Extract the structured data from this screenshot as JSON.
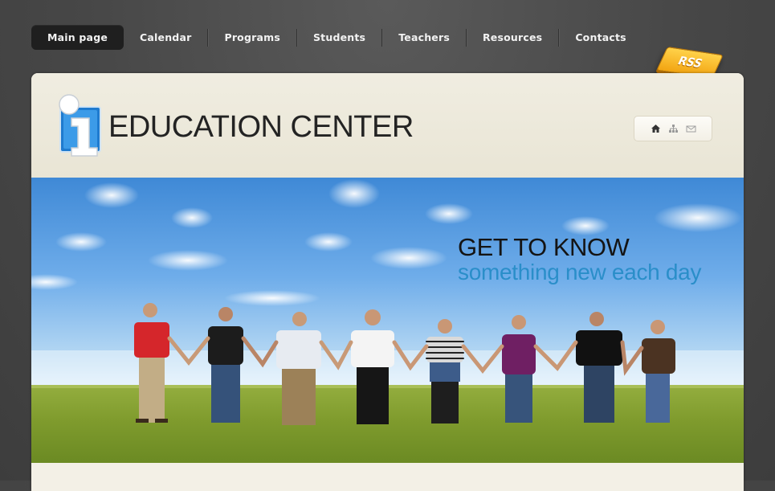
{
  "nav": {
    "items": [
      {
        "label": "Main page",
        "active": true
      },
      {
        "label": "Calendar"
      },
      {
        "label": "Programs"
      },
      {
        "label": "Students"
      },
      {
        "label": "Teachers"
      },
      {
        "label": "Resources"
      },
      {
        "label": "Contacts"
      }
    ]
  },
  "rss_badge": {
    "label": "RSS",
    "color": "#f5b21c"
  },
  "header": {
    "title": "EDUCATION CENTER",
    "logo_icon": "info-i-icon",
    "util_icons": [
      "home-icon",
      "sitemap-icon",
      "mail-icon"
    ]
  },
  "banner": {
    "headline": "GET TO KNOW",
    "subline": "something new each day",
    "subline_color": "#2a8ec9",
    "image": "people-holding-hands-photo"
  },
  "colors": {
    "background": "#474747",
    "panel": "#efece0",
    "nav_active": "#1f1f1f"
  }
}
